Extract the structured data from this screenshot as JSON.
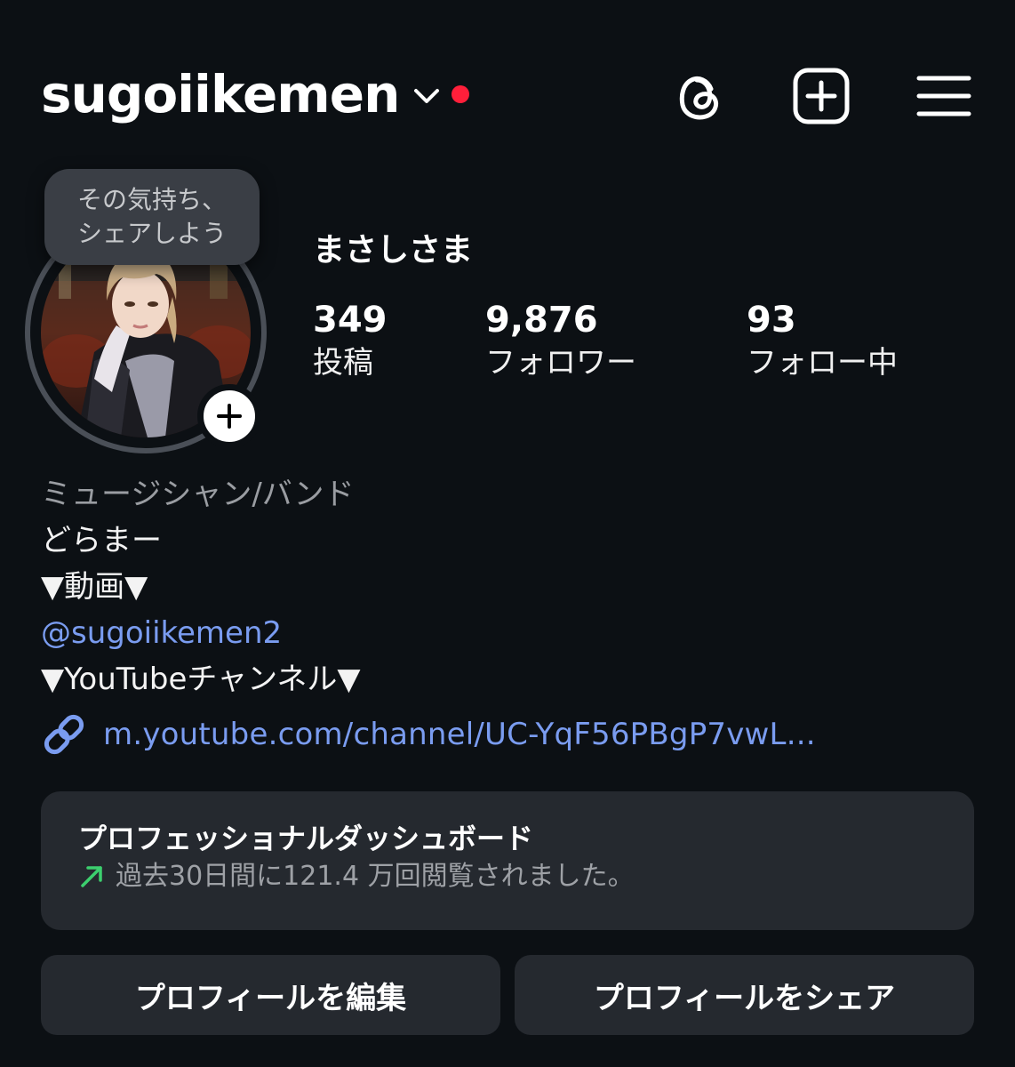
{
  "header": {
    "username": "sugoiikemen",
    "icons": [
      "chevron-down-icon",
      "threads-icon",
      "create-post-icon",
      "menu-icon"
    ],
    "notification_dot_color": "#ff1f3a"
  },
  "profile": {
    "note": {
      "line1": "その気持ち、",
      "line2": "シェアしよう"
    },
    "display_name": "まさしさま",
    "stats": {
      "posts": {
        "value": "349",
        "label": "投稿"
      },
      "followers": {
        "value": "9,876",
        "label": "フォロワー"
      },
      "following": {
        "value": "93",
        "label": "フォロー中"
      }
    }
  },
  "bio": {
    "category": "ミュージシャン/バンド",
    "line1": "どらまー",
    "line2": "▼動画▼",
    "mention": "@sugoiikemen2",
    "line3": "▼YouTubeチャンネル▼",
    "link": "m.youtube.com/channel/UC-YqF56PBgP7vwL..."
  },
  "dashboard": {
    "title": "プロフェッショナルダッシュボード",
    "subtitle": "過去30日間に121.4 万回閲覧されました。",
    "trend_color": "#3ccf6e"
  },
  "buttons": {
    "edit": "プロフィールを編集",
    "share": "プロフィールをシェア"
  },
  "colors": {
    "background": "#0c1014",
    "link": "#7a9cf0",
    "card": "#25292f"
  }
}
